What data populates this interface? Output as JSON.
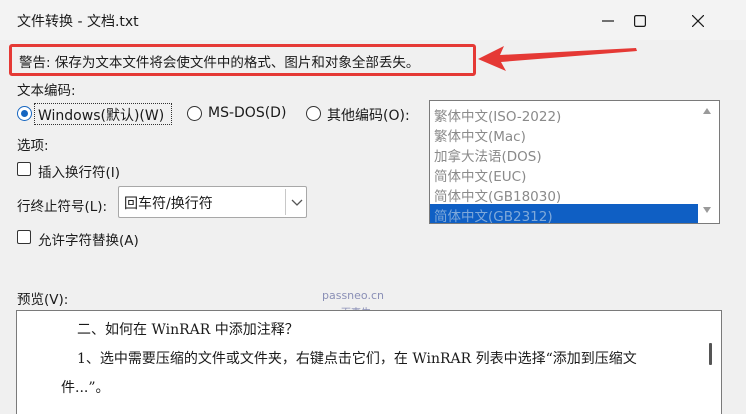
{
  "window": {
    "title": "文件转换 - 文档.txt",
    "controls": {
      "minimize": "minimize-icon",
      "maximize": "maximize-icon",
      "close": "close-icon"
    }
  },
  "warning": {
    "text": "警告: 保存为文本文件将会使文件中的格式、图片和对象全部丢失。",
    "highlight_color": "#e53935"
  },
  "encoding": {
    "group_label": "文本编码:",
    "options": [
      {
        "label": "Windows(默认)(W)",
        "selected": true
      },
      {
        "label": "MS-DOS(D)",
        "selected": false
      },
      {
        "label": "其他编码(O):",
        "selected": false
      }
    ],
    "list_items": [
      "繁体中文(ISO-2022)",
      "繁体中文(Mac)",
      "加拿大法语(DOS)",
      "简体中文(EUC)",
      "简体中文(GB18030)",
      "简体中文(GB2312)"
    ],
    "selected_item": "简体中文(GB2312)",
    "accent_color": "#0f5fc4"
  },
  "options": {
    "group_label": "选项:",
    "insert_line_breaks": {
      "label": "插入换行符(I)",
      "checked": false
    },
    "line_end_label": "行终止符号(L):",
    "line_end_value": "回车符/换行符",
    "allow_substitution": {
      "label": "允许字符替换(A)",
      "checked": false
    }
  },
  "watermark": {
    "line1": "passneo.cn",
    "line2": "百事牛"
  },
  "preview": {
    "label": "预览(V):",
    "lines": [
      "二、如何在 WinRAR 中添加注释？",
      "1、选中需要压缩的文件或文件夹，右键点击它们，在 WinRAR 列表中选择“添加到压缩文",
      "件...”。"
    ]
  }
}
